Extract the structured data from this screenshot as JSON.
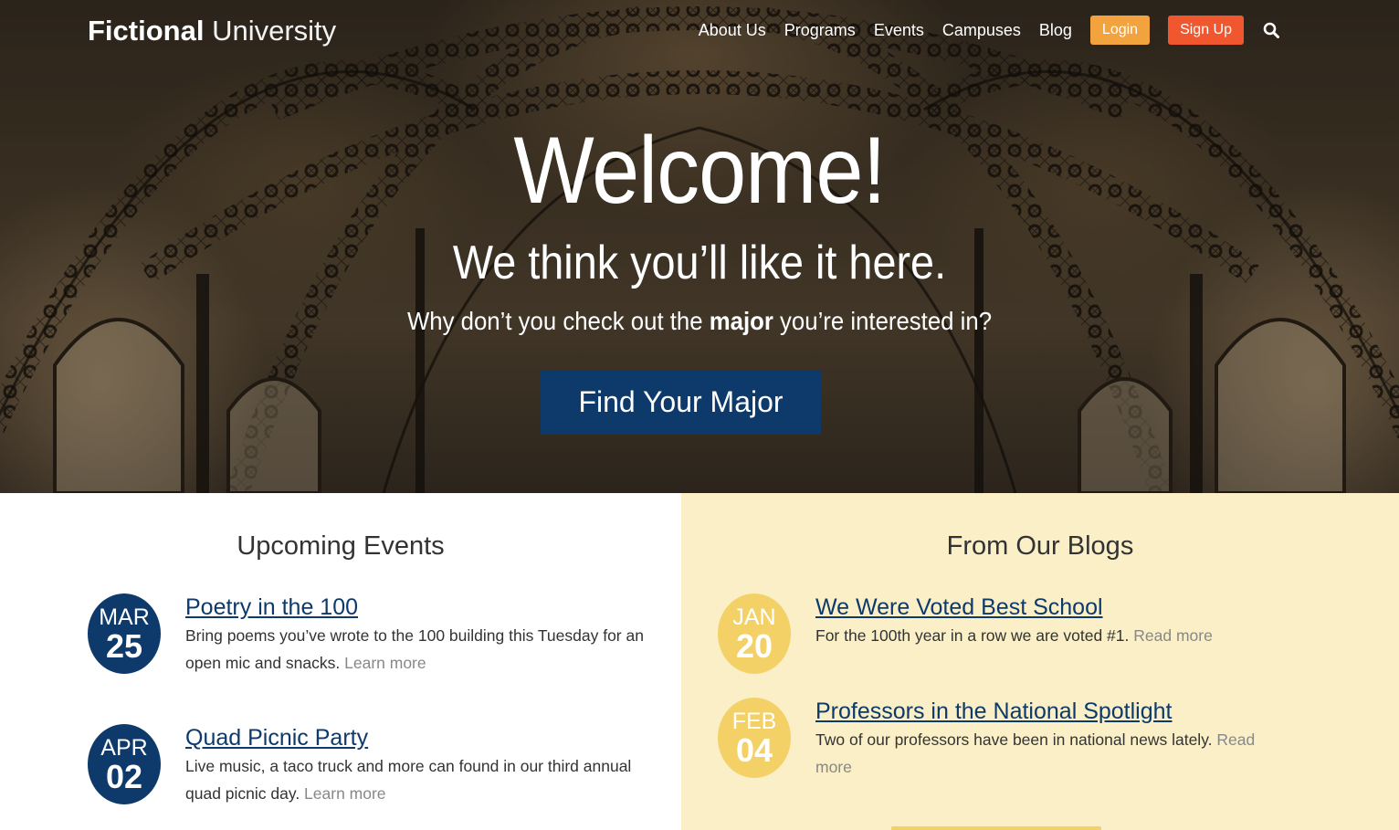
{
  "header": {
    "logo_bold": "Fictional",
    "logo_light": "University",
    "nav": [
      "About Us",
      "Programs",
      "Events",
      "Campuses",
      "Blog"
    ],
    "login_label": "Login",
    "signup_label": "Sign Up",
    "search_icon": "search-icon"
  },
  "hero": {
    "title": "Welcome!",
    "subtitle": "We think you’ll like it here.",
    "line_pre": "Why don’t you check out the ",
    "line_bold": "major",
    "line_post": " you’re interested in?",
    "cta": "Find Your Major"
  },
  "events": {
    "heading": "Upcoming Events",
    "items": [
      {
        "month": "MAR",
        "day": "25",
        "title": "Poetry in the 100",
        "text": "Bring poems you’ve wrote to the 100 building this Tuesday for an open mic and snacks. ",
        "more": "Learn more"
      },
      {
        "month": "APR",
        "day": "02",
        "title": "Quad Picnic Party",
        "text": "Live music, a taco truck and more can found in our third annual quad picnic day. ",
        "more": "Learn more"
      }
    ]
  },
  "blogs": {
    "heading": "From Our Blogs",
    "items": [
      {
        "month": "JAN",
        "day": "20",
        "title": "We Were Voted Best School",
        "text": "For the 100th year in a row we are voted #1. ",
        "more": "Read more"
      },
      {
        "month": "FEB",
        "day": "04",
        "title": "Professors in the National Spotlight",
        "text": "Two of our professors have been in national news lately. ",
        "more": "Read more"
      }
    ]
  },
  "colors": {
    "navy": "#0d3a6b",
    "gold": "#f3d167",
    "login": "#f2a33e",
    "signup": "#f0572f",
    "blog_bg": "#faefc6"
  }
}
